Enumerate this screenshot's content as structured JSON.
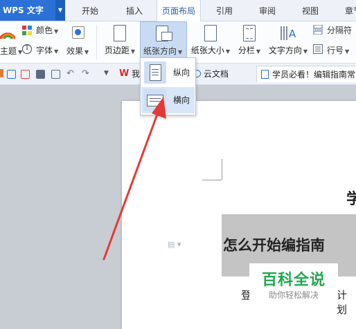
{
  "app": {
    "title": "WPS 文字"
  },
  "tabs": [
    {
      "label": "开始",
      "active": false
    },
    {
      "label": "插入",
      "active": false
    },
    {
      "label": "页面布局",
      "active": true
    },
    {
      "label": "引用",
      "active": false
    },
    {
      "label": "审阅",
      "active": false
    },
    {
      "label": "视图",
      "active": false
    },
    {
      "label": "章节",
      "active": false
    }
  ],
  "ribbon": {
    "theme_label": "主题",
    "colors_label": "颜色",
    "font_label": "字体",
    "effects_label": "效果",
    "margins_label": "页边距",
    "orientation_label": "纸张方向",
    "size_label": "纸张大小",
    "columns_label": "分栏",
    "text_direction_label": "文字方向",
    "breaks_label": "分隔符",
    "line_numbers_label": "行号"
  },
  "orientation_menu": {
    "portrait_label": "纵向",
    "landscape_label": "横向",
    "hovered": "landscape"
  },
  "quickbar": {
    "doc_tabs": [
      {
        "label": "我"
      },
      {
        "label": "云文档"
      },
      {
        "label": "学员必看！编辑指南常"
      }
    ]
  },
  "document": {
    "heading": "怎么开始编指南",
    "fragment_top": "学",
    "fragment_left": "登",
    "fragment_right": "计划"
  },
  "watermark": {
    "title": "百科全说",
    "subtitle": "助你轻松解决"
  },
  "colors": {
    "accent": "#2b71d6",
    "arrow": "#e53935",
    "watermark_green": "#1fa84d"
  }
}
